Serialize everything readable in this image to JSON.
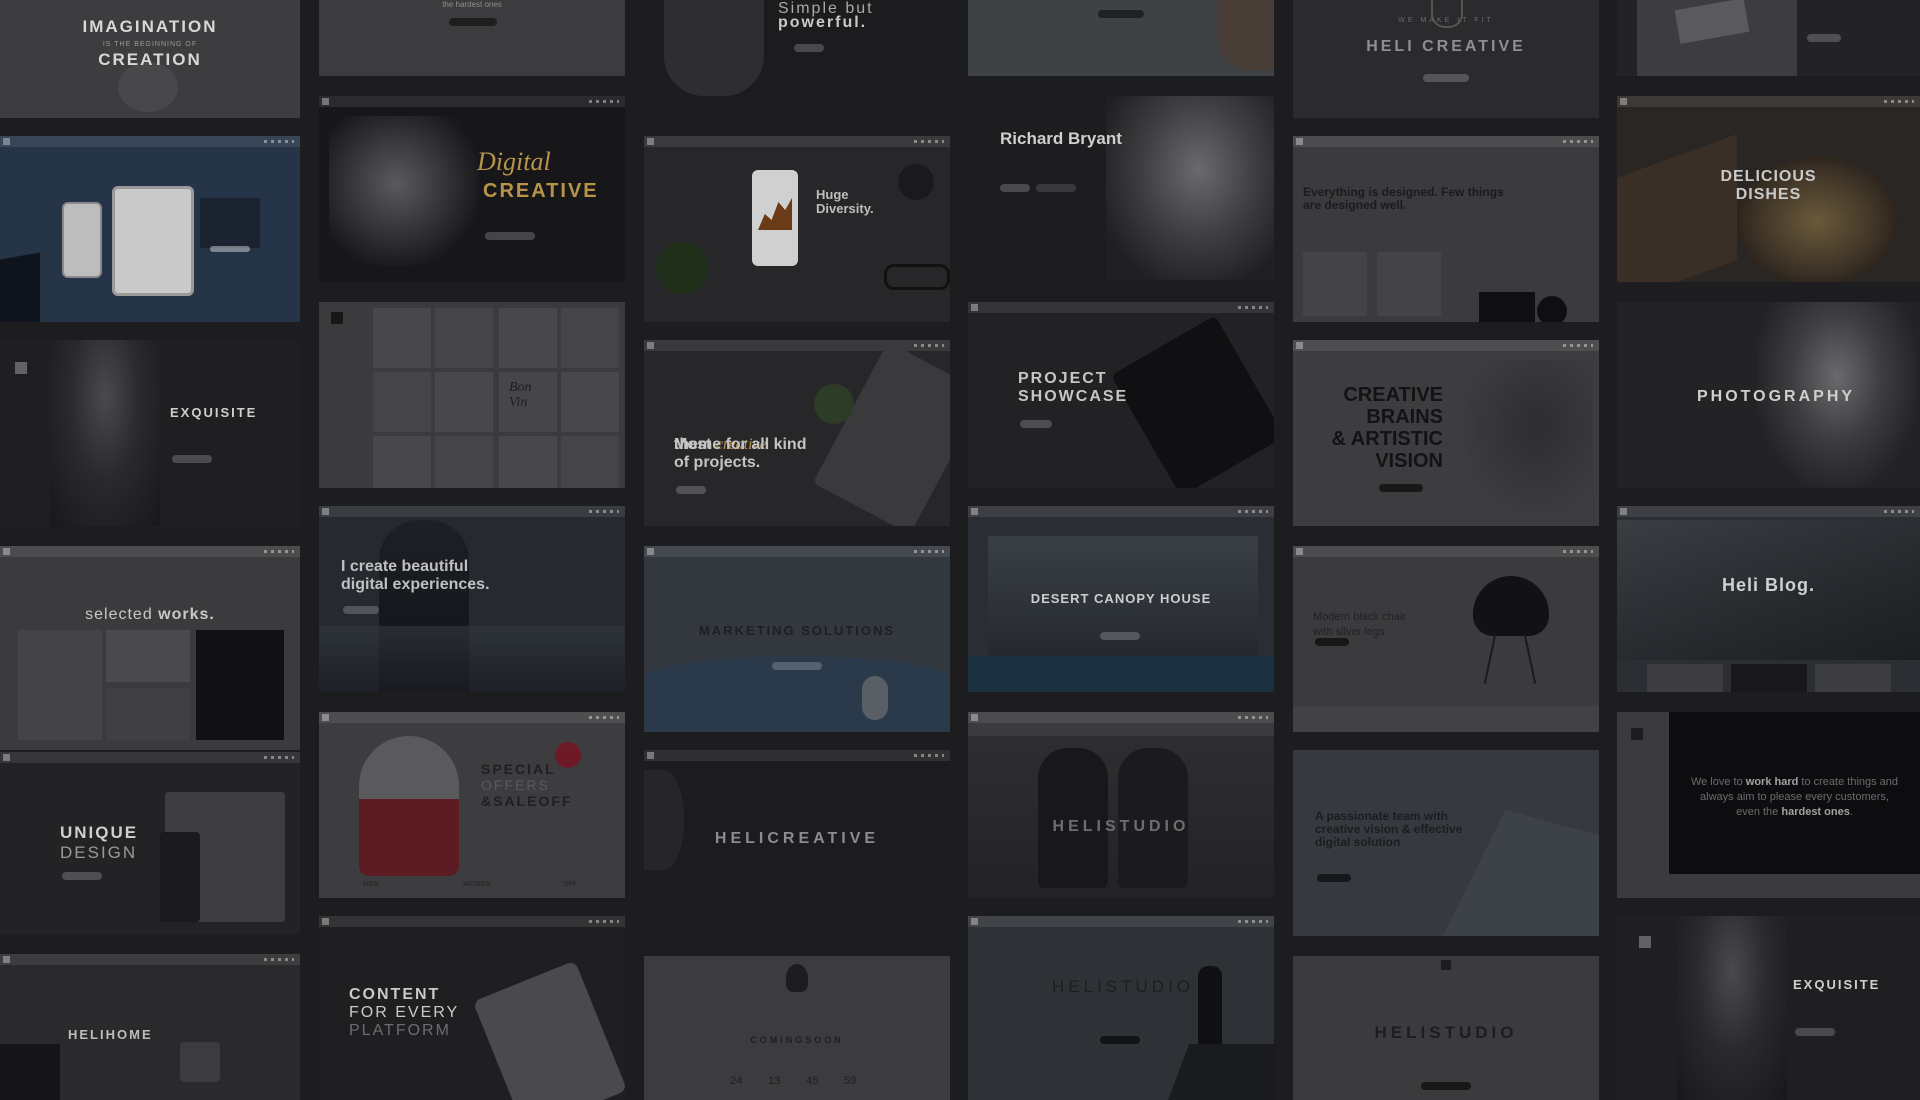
{
  "colors": {
    "page_background": "#1d1d20",
    "accent_gold": "#b89449",
    "accent_red": "#c4243a"
  },
  "tiles": {
    "imagination": {
      "title": "IMAGINATION",
      "tagline": "IS THE BEGINNING OF",
      "title2": "CREATION"
    },
    "hardest": {
      "text": "the hardest ones"
    },
    "simple": {
      "line1": "Simple but",
      "line2": "powerful."
    },
    "heli_creative_top": {
      "tagline": "WE MAKE IT FIT",
      "title": "HELI CREATIVE"
    },
    "digital_creative": {
      "line1": "Digital",
      "line2": "CREATIVE"
    },
    "huge_diversity": {
      "line1": "Huge",
      "line2": "Diversity."
    },
    "richard": {
      "name": "Richard Bryant"
    },
    "everything": {
      "text": "Everything is designed. Few things\nare designed well."
    },
    "delicious": {
      "title": "DELICIOUS\nDISHES"
    },
    "exquisite_left": {
      "title": "EXQUISITE"
    },
    "bon_vin": {
      "text": "Bon\nVin"
    },
    "most_creative": {
      "line1": "Most",
      "italic": "creative",
      "line2": "theme for all kind\nof projects."
    },
    "project_showcase": {
      "title": "PROJECT\nSHOWCASE"
    },
    "creative_brains": {
      "title": "CREATIVE\nBRAINS\n& ARTISTIC\nVISION"
    },
    "photography": {
      "title": "PHOTOGRAPHY"
    },
    "i_create": {
      "text": "I create beautiful\ndigital experiences."
    },
    "marketing": {
      "title": "MARKETING SOLUTIONS"
    },
    "desert": {
      "title": "DESERT CANOPY HOUSE"
    },
    "modern_chair": {
      "text": "Modern black chair\nwith silver legs"
    },
    "heli_blog": {
      "title": "Heli Blog."
    },
    "selected_works": {
      "light": "selected",
      "bold": "works."
    },
    "special_offers": {
      "line1": "SPECIAL",
      "line2": "OFFERS",
      "line3": "&SALEOFF",
      "labels": [
        "MEN",
        "WOMEN",
        "OFF"
      ]
    },
    "heli_creative_mid": {
      "title": "HELICREATIVE"
    },
    "heli_studio_mid": {
      "title": "HELISTUDIO"
    },
    "passionate": {
      "text": "A passionate team with\ncreative vision & effective\ndigital solution"
    },
    "work_hard": {
      "pre": "We love to ",
      "bold1": "work hard",
      "mid": " to create things and\nalways aim to please every customers,\neven the ",
      "bold2": "hardest ones",
      "end": "."
    },
    "unique_design": {
      "line1": "UNIQUE",
      "line2": "DESIGN"
    },
    "content_every": {
      "line1": "CONTENT",
      "line2": "FOR EVERY",
      "line3": "PLATFORM"
    },
    "heli_studio_sea": {
      "title": "HELISTUDIO"
    },
    "heli_studio_light": {
      "title": "HELISTUDIO"
    },
    "heli_home": {
      "title": "HELIHOME"
    },
    "coming_soon": {
      "title": "COMINGSOON",
      "countdown": [
        "24",
        "13",
        "45",
        "59"
      ]
    },
    "exquisite_right": {
      "title": "EXQUISITE"
    }
  }
}
